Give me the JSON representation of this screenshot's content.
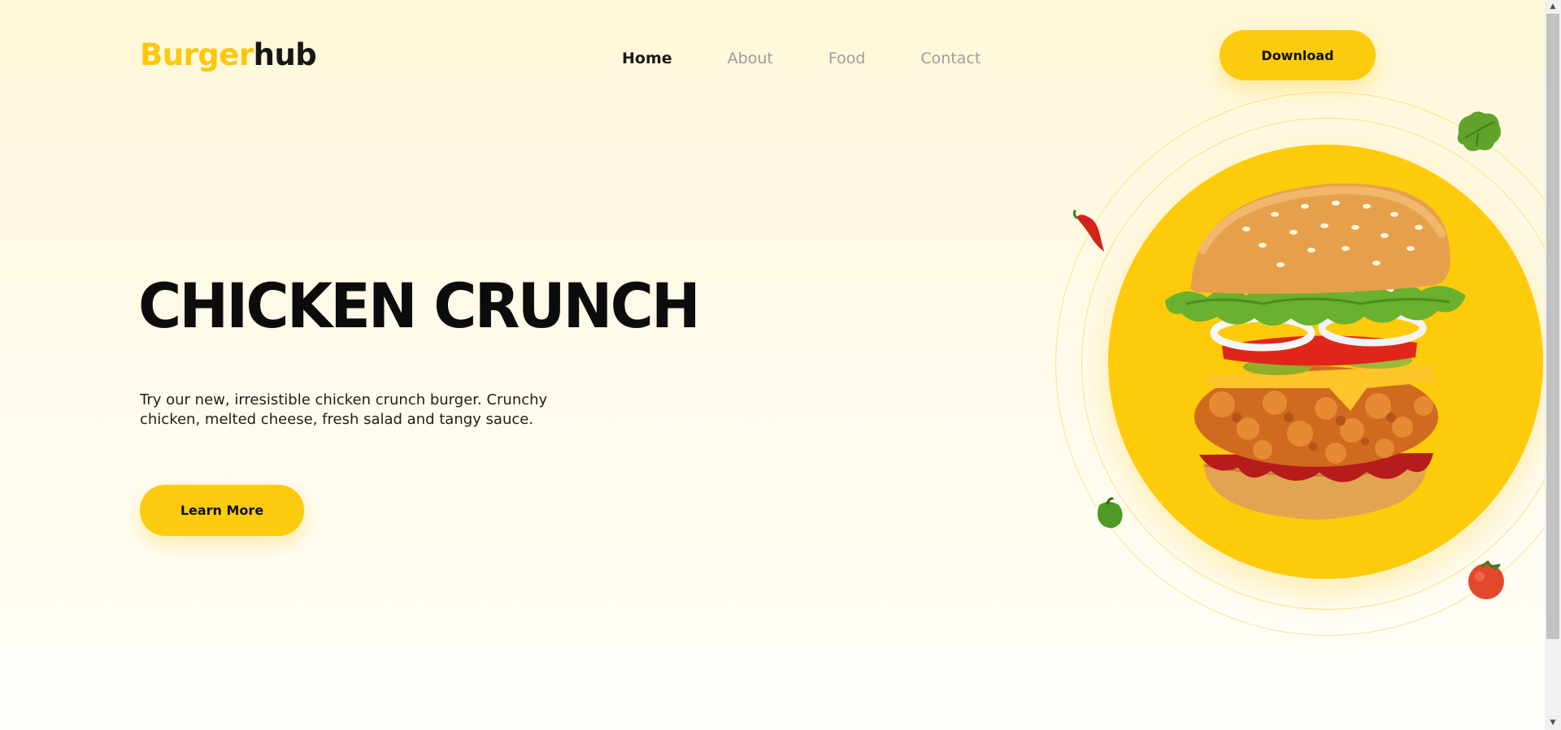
{
  "brand": {
    "part1": "Burger",
    "part2": "hub"
  },
  "nav": {
    "items": [
      {
        "label": "Home",
        "active": true
      },
      {
        "label": "About",
        "active": false
      },
      {
        "label": "Food",
        "active": false
      },
      {
        "label": "Contact",
        "active": false
      }
    ]
  },
  "header": {
    "download_label": "Download"
  },
  "hero": {
    "title": "CHICKEN CRUNCH",
    "description": "Try our new, irresistible chicken crunch burger. Crunchy chicken, melted cheese, fresh salad and tangy sauce.",
    "cta_label": "Learn More"
  },
  "colors": {
    "accent": "#fdcb0e",
    "brand_yellow": "#fdc80c",
    "text_dark": "#111111",
    "nav_inactive": "#9d9d9d",
    "bg_top": "#fff7d8"
  },
  "icons": {
    "scroll_up": "scroll-up-arrow-icon",
    "scroll_down": "scroll-down-arrow-icon",
    "decorations": [
      "lettuce-leaf-icon",
      "chili-pepper-icon",
      "green-pepper-icon",
      "tomato-icon"
    ]
  }
}
